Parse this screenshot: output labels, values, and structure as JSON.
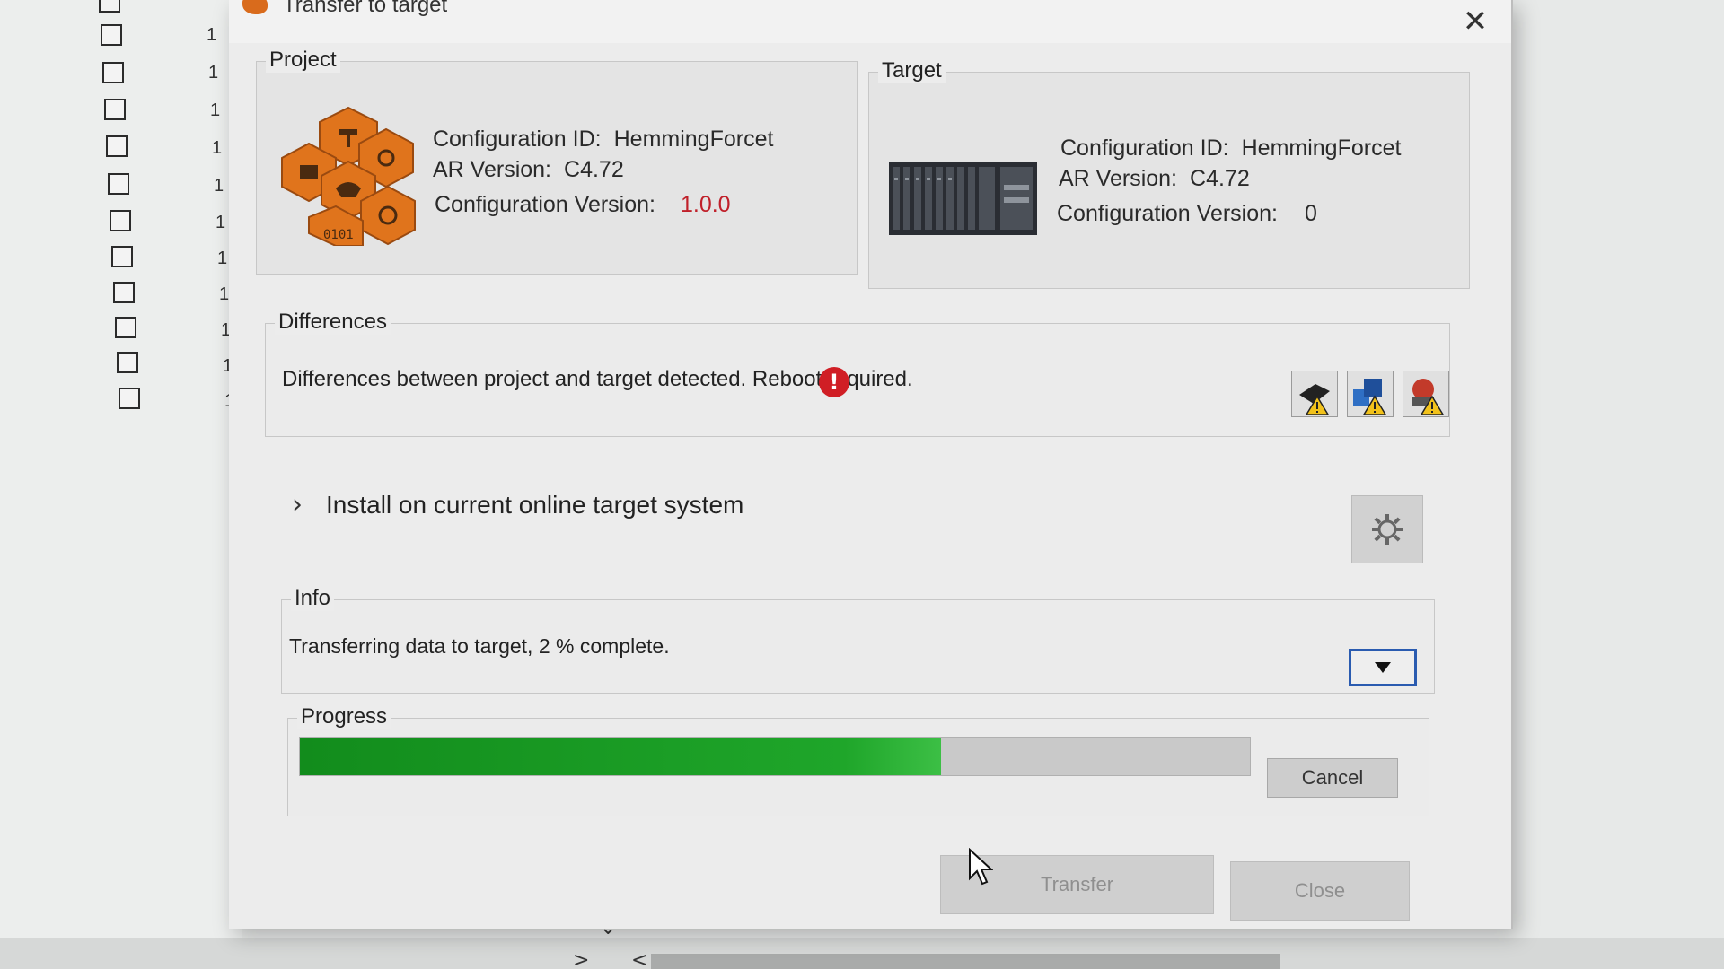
{
  "dialog": {
    "title": "Transfer to target",
    "close_glyph": "✕"
  },
  "project": {
    "group_title": "Project",
    "config_id_label": "Configuration ID:",
    "config_id": "HemmingForcet",
    "ar_version_label": "AR Version:",
    "ar_version": "C4.72",
    "config_version_label": "Configuration Version:",
    "config_version": "1.0.0"
  },
  "target": {
    "group_title": "Target",
    "config_id_label": "Configuration ID:",
    "config_id": "HemmingForcet",
    "ar_version_label": "AR Version:",
    "ar_version": "C4.72",
    "config_version_label": "Configuration Version:",
    "config_version": "0"
  },
  "differences": {
    "group_title": "Differences",
    "message": "Differences between project and target detected. Reboot required.",
    "status_icon": "error-icon",
    "buttons": [
      "hardware-warning-icon",
      "software-warning-icon",
      "config-warning-icon"
    ]
  },
  "install": {
    "chevron": "›",
    "label": "Install on current online target system",
    "settings_icon": "gear-icon"
  },
  "info": {
    "group_title": "Info",
    "message": "Transferring data to target, 2 % complete."
  },
  "progress": {
    "group_title": "Progress",
    "fraction": 0.675,
    "cancel_label": "Cancel"
  },
  "buttons": {
    "transfer_label": "Transfer",
    "close_label": "Close"
  },
  "background": {
    "row_numbers": [
      "1",
      "1",
      "1",
      "1",
      "1",
      "1",
      "1",
      "1",
      "1",
      "1",
      "1"
    ],
    "arrow_left": "<",
    "arrow_right": ">",
    "arrow_down": "⌄"
  },
  "colors": {
    "progress_green": "#1fa62a",
    "version_red": "#c0202a",
    "dropdown_border": "#2a5bb0",
    "icon_orange": "#d96b1c"
  }
}
